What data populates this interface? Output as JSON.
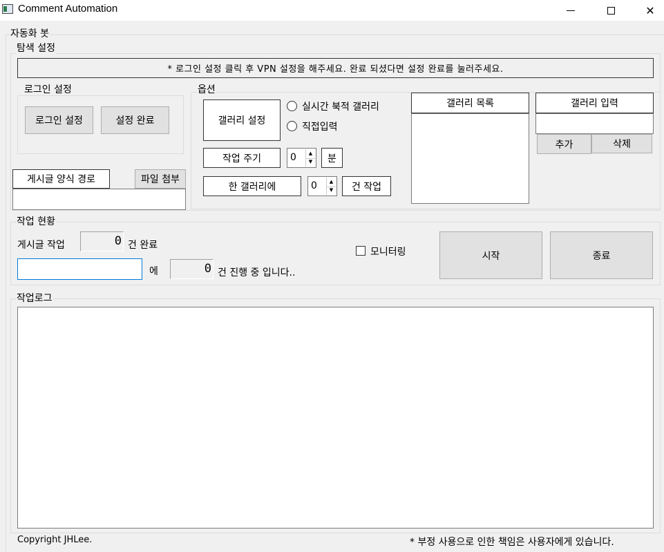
{
  "window": {
    "title": "Comment Automation",
    "minimize": "",
    "maximize": "",
    "close": "✕"
  },
  "bot_group": {
    "legend": "자동화 봇"
  },
  "search_settings": {
    "legend": "탐색 설정",
    "notice": "* 로그인 설정 클릭 후 VPN 설정을 해주세요. 완료 되셨다면 설정 완료를 눌러주세요."
  },
  "login_settings": {
    "legend": "로그인 설정",
    "login_button": "로그인 설정",
    "done_button": "설정 완료"
  },
  "post_template": {
    "label": "게시글 양식 경로",
    "attach_button": "파일 첨부",
    "path_value": ""
  },
  "options": {
    "legend": "옵션",
    "gallery_settings_button": "갤러리 설정",
    "radio_realtime": "실시간 북적 갤러리",
    "radio_direct": "직접입력",
    "cycle_label": "작업 주기",
    "cycle_value": "0",
    "cycle_unit": "분",
    "per_gallery_label": "한 갤러리에",
    "per_gallery_value": "0",
    "per_gallery_unit": "건 작업"
  },
  "gallery_list": {
    "header": "갤러리 목록",
    "items": []
  },
  "gallery_input": {
    "header": "갤러리 입력",
    "value": "",
    "add_button": "추가",
    "delete_button": "삭제"
  },
  "status": {
    "legend": "작업 현황",
    "post_label": "게시글 작업",
    "post_count": "0",
    "post_suffix": "건 완료",
    "target_value": "",
    "target_suffix": "에",
    "progress_count": "0",
    "progress_suffix": "건 진행 중 입니다..",
    "monitoring_label": "모니터링",
    "monitoring_checked": false,
    "start_button": "시작",
    "stop_button": "종료"
  },
  "log": {
    "legend": "작업로그",
    "content": ""
  },
  "footer": {
    "copyright": "Copyright JHLee.",
    "disclaimer": "* 부정 사용으로 인한 책임은 사용자에게 있습니다."
  }
}
